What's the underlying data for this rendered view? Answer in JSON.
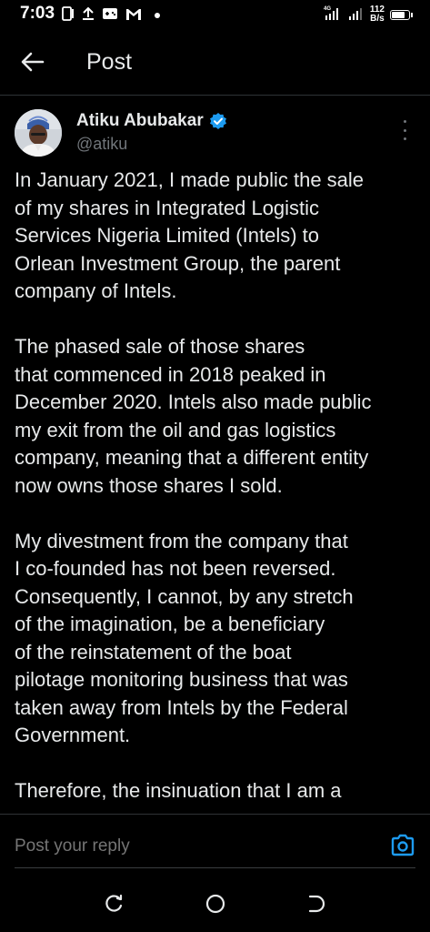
{
  "status_bar": {
    "time": "7:03",
    "network_speed_value": "112",
    "network_speed_unit": "B/s",
    "network_type": "4G",
    "battery_level": 0.85,
    "icons": [
      "sim-card-icon",
      "upload-icon",
      "gamepad-icon",
      "gmail-icon",
      "notification-dot-icon",
      "signal-icon",
      "battery-icon"
    ]
  },
  "header": {
    "title": "Post",
    "back_icon": "arrow-left-icon"
  },
  "author": {
    "name": "Atiku Abubakar",
    "handle": "@atiku",
    "verified": true
  },
  "post": {
    "paragraphs": [
      "In January 2021, I made public the sale\nof my shares in Integrated Logistic\nServices Nigeria Limited (Intels) to\nOrlean Investment Group, the parent\ncompany of Intels.",
      "The phased sale of those shares\nthat commenced in 2018 peaked in\nDecember 2020. Intels also made public\nmy exit from the oil and gas logistics\ncompany, meaning that a different entity\nnow owns those shares I sold.",
      "My divestment from the company that\nI co-founded has not been reversed.\nConsequently, I cannot, by any stretch\nof the imagination, be a beneficiary\nof the reinstatement of the boat\npilotage monitoring business that was\ntaken away from Intels by the Federal\nGovernment.",
      "Therefore, the insinuation that I am a"
    ]
  },
  "reply": {
    "placeholder": "Post your reply",
    "camera_icon": "camera-icon"
  },
  "colors": {
    "background": "#000000",
    "text": "#e7e9ea",
    "muted": "#71767b",
    "accent": "#1d9bf0",
    "divider": "#2f3336"
  }
}
